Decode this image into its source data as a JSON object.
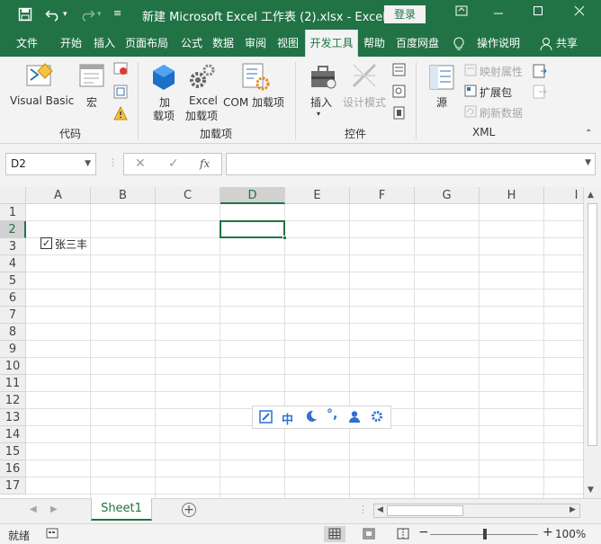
{
  "titlebar": {
    "title": "新建 Microsoft Excel 工作表 (2).xlsx  -  Excel",
    "login_label": "登录",
    "icons": [
      "save-icon",
      "undo-icon",
      "redo-icon",
      "customize-qat-icon"
    ]
  },
  "tabs": [
    {
      "label": "文件",
      "active": false
    },
    {
      "label": "开始",
      "active": false
    },
    {
      "label": "插入",
      "active": false
    },
    {
      "label": "页面布局",
      "active": false
    },
    {
      "label": "公式",
      "active": false
    },
    {
      "label": "数据",
      "active": false
    },
    {
      "label": "审阅",
      "active": false
    },
    {
      "label": "视图",
      "active": false
    },
    {
      "label": "开发工具",
      "active": true
    },
    {
      "label": "帮助",
      "active": false
    },
    {
      "label": "百度网盘",
      "active": false
    }
  ],
  "tell_me": "操作说明",
  "share": "共享",
  "ribbon": {
    "code": {
      "name": "代码",
      "visual_basic": "Visual Basic",
      "macro": "宏"
    },
    "addins": {
      "name": "加载项",
      "addin_line1": "加",
      "addin_line2": "载项",
      "excel_addin_line1": "Excel",
      "excel_addin_line2": "加载项",
      "com_addin": "COM 加载项"
    },
    "controls": {
      "name": "控件",
      "insert": "插入",
      "design_mode": "设计模式"
    },
    "xml": {
      "name": "XML",
      "source": "源",
      "map_properties": "映射属性",
      "expansion_packs": "扩展包",
      "refresh_data": "刷新数据"
    }
  },
  "formula_bar": {
    "name_box": "D2",
    "formula": "",
    "fx": "fx"
  },
  "grid": {
    "columns": [
      "A",
      "B",
      "C",
      "D",
      "E",
      "F",
      "G",
      "H",
      "I"
    ],
    "rows": [
      "1",
      "2",
      "3",
      "4",
      "5",
      "6",
      "7",
      "8",
      "9",
      "10",
      "11",
      "12",
      "13",
      "14",
      "15",
      "16",
      "17"
    ],
    "selected_column": "D",
    "selected_row": "2",
    "active_cell": "D2",
    "checkbox": {
      "label": "张三丰",
      "checked": true
    }
  },
  "sheets": [
    {
      "name": "Sheet1",
      "active": true
    }
  ],
  "status": {
    "ready": "就绪",
    "zoom": "100%"
  },
  "colors": {
    "accent": "#217346",
    "ime_blue": "#2f6fd6"
  }
}
